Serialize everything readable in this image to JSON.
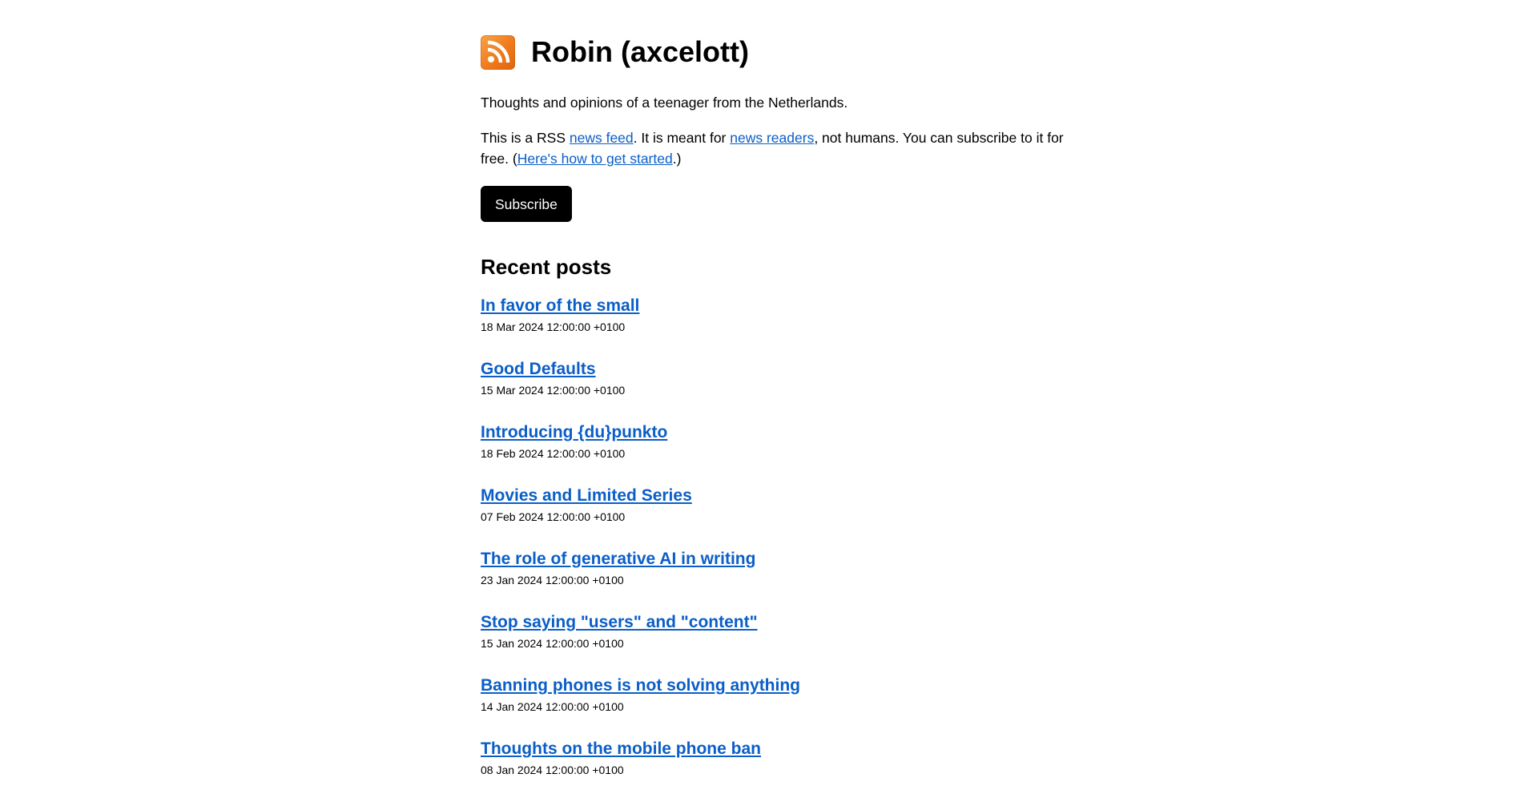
{
  "site": {
    "title": "Robin (axcelott)",
    "logo_icon": "rss-feed-icon",
    "tagline": "Thoughts and opinions of a teenager from the Netherlands."
  },
  "notice": {
    "text_1": "This is a RSS ",
    "link_news_feed": "news feed",
    "text_2": ". It is meant for ",
    "link_news_readers": "news readers",
    "text_3": ", not humans. You can subscribe to it for free. (",
    "link_get_started": "Here's how to get started",
    "text_4": ".)"
  },
  "subscribe": {
    "label": "Subscribe"
  },
  "recent": {
    "heading": "Recent posts",
    "posts": [
      {
        "title": "In favor of the small",
        "date": "18 Mar 2024 12:00:00 +0100"
      },
      {
        "title": "Good Defaults",
        "date": "15 Mar 2024 12:00:00 +0100"
      },
      {
        "title": "Introducing {du}punkto",
        "date": "18 Feb 2024 12:00:00 +0100"
      },
      {
        "title": "Movies and Limited Series",
        "date": "07 Feb 2024 12:00:00 +0100"
      },
      {
        "title": "The role of generative AI in writing",
        "date": "23 Jan 2024 12:00:00 +0100"
      },
      {
        "title": "Stop saying \"users\" and \"content\"",
        "date": "15 Jan 2024 12:00:00 +0100"
      },
      {
        "title": "Banning phones is not solving anything",
        "date": "14 Jan 2024 12:00:00 +0100"
      },
      {
        "title": "Thoughts on the mobile phone ban",
        "date": "08 Jan 2024 12:00:00 +0100"
      }
    ]
  },
  "colors": {
    "link": "#0a5ec8",
    "rss_orange": "#ef7b1c",
    "button_bg": "#000000",
    "button_text": "#ffffff"
  }
}
